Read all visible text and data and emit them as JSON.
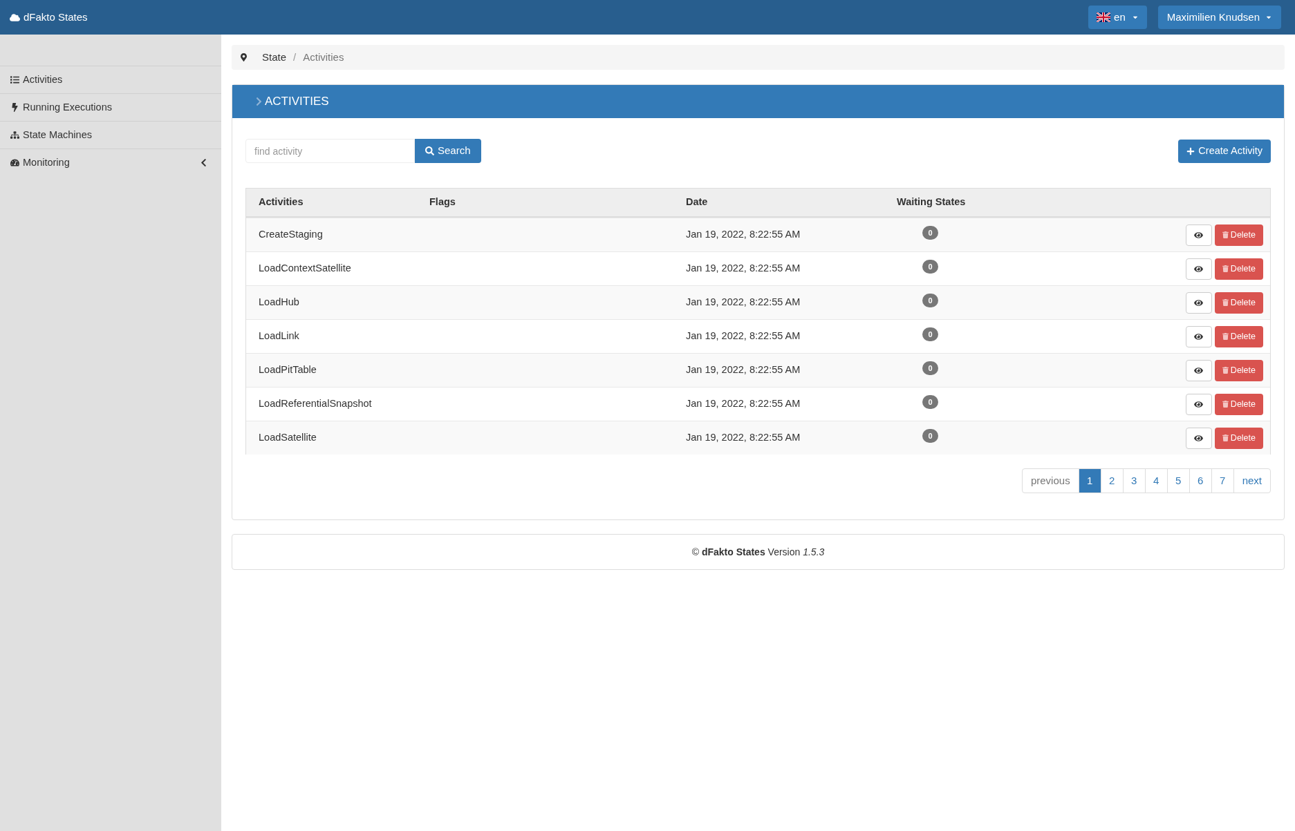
{
  "navbar": {
    "brand": "dFakto States",
    "language": "en",
    "user": "Maximilien Knudsen"
  },
  "sidebar": {
    "items": [
      {
        "label": "Activities",
        "kind": "link"
      },
      {
        "label": "Running Executions",
        "kind": "link"
      },
      {
        "label": "State Machines",
        "kind": "link"
      },
      {
        "label": "Monitoring",
        "kind": "group"
      }
    ]
  },
  "breadcrumb": {
    "separator": "/",
    "items": [
      {
        "label": "State",
        "selected": false
      },
      {
        "label": "Activities",
        "selected": true
      }
    ]
  },
  "panel": {
    "title": "ACTIVITIES",
    "search": {
      "placeholder": "find activity",
      "button": "Search"
    },
    "create_button": "Create Activity",
    "table": {
      "columns": [
        "Activities",
        "Flags",
        "Date",
        "Waiting States"
      ],
      "rows": [
        {
          "name": "CreateStaging",
          "date": "Jan 19, 2022, 8:22:55 AM",
          "waiting": "0",
          "delete": "Delete"
        },
        {
          "name": "LoadContextSatellite",
          "date": "Jan 19, 2022, 8:22:55 AM",
          "waiting": "0",
          "delete": "Delete"
        },
        {
          "name": "LoadHub",
          "date": "Jan 19, 2022, 8:22:55 AM",
          "waiting": "0",
          "delete": "Delete"
        },
        {
          "name": "LoadLink",
          "date": "Jan 19, 2022, 8:22:55 AM",
          "waiting": "0",
          "delete": "Delete"
        },
        {
          "name": "LoadPitTable",
          "date": "Jan 19, 2022, 8:22:55 AM",
          "waiting": "0",
          "delete": "Delete"
        },
        {
          "name": "LoadReferentialSnapshot",
          "date": "Jan 19, 2022, 8:22:55 AM",
          "waiting": "0",
          "delete": "Delete"
        },
        {
          "name": "LoadSatellite",
          "date": "Jan 19, 2022, 8:22:55 AM",
          "waiting": "0",
          "delete": "Delete"
        }
      ]
    },
    "pagination": {
      "previous": {
        "label": "previous",
        "disabled": true
      },
      "pages": [
        {
          "label": "1",
          "selected": true
        },
        {
          "label": "2",
          "selected": false
        },
        {
          "label": "3",
          "selected": false
        },
        {
          "label": "4",
          "selected": false
        },
        {
          "label": "5",
          "selected": false
        },
        {
          "label": "6",
          "selected": false
        },
        {
          "label": "7",
          "selected": false
        }
      ],
      "next": {
        "label": "next",
        "disabled": false
      }
    }
  },
  "footer": "© **dFakto States** Version *1.5.3*"
}
